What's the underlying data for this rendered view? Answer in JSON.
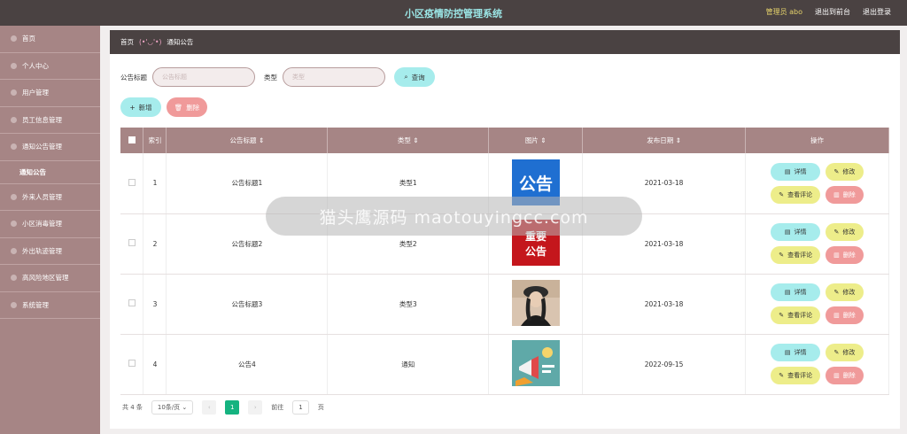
{
  "header": {
    "title": "小区疫情防控管理系统",
    "user": "管理员 abo",
    "to_front": "退出到前台",
    "logout": "退出登录"
  },
  "sidebar": {
    "items": [
      {
        "label": "首页"
      },
      {
        "label": "个人中心"
      },
      {
        "label": "用户管理"
      },
      {
        "label": "员工信息管理"
      },
      {
        "label": "通知公告管理"
      }
    ],
    "sub_active": "通知公告",
    "items_after": [
      {
        "label": "外来人员管理"
      },
      {
        "label": "小区消毒管理"
      },
      {
        "label": "外出轨迹管理"
      },
      {
        "label": "高风险地区管理"
      },
      {
        "label": "系统管理"
      }
    ]
  },
  "breadcrumb": {
    "home": "首页",
    "face": "(•'◡'•)",
    "current": "通知公告"
  },
  "search": {
    "title_label": "公告标题",
    "title_placeholder": "公告标题",
    "type_label": "类型",
    "type_placeholder": "类型",
    "query_button": "查询"
  },
  "toolbar": {
    "add": "新增",
    "delete": "删除"
  },
  "table": {
    "columns": [
      "索引",
      "公告标题",
      "类型",
      "图片",
      "发布日期",
      "操作"
    ],
    "rows": [
      {
        "index": "1",
        "title": "公告标题1",
        "type": "类型1",
        "image": "notice-gonggao-blue",
        "date": "2021-03-18"
      },
      {
        "index": "2",
        "title": "公告标题2",
        "type": "类型2",
        "image": "notice-zhongyao-red",
        "date": "2021-03-18"
      },
      {
        "index": "3",
        "title": "公告标题3",
        "type": "类型3",
        "image": "photo-person",
        "date": "2021-03-18"
      },
      {
        "index": "4",
        "title": "公告4",
        "type": "通知",
        "image": "megaphone-illustration",
        "date": "2022-09-15"
      }
    ],
    "actions": {
      "detail": "详情",
      "edit": "修改",
      "comments": "查看评论",
      "delete": "删除"
    }
  },
  "pagination": {
    "total": "共 4 条",
    "page_size": "10条/页",
    "current_page": "1",
    "goto_label": "前往",
    "goto_value": "1",
    "page_suffix": "页"
  },
  "watermark": "猫头鹰源码 maotouyingcc.com",
  "colors": {
    "header_bg": "#4a4242",
    "sidebar_bg": "#a68585",
    "accent_cyan": "#a6ecec",
    "accent_pink": "#f09a9a",
    "accent_yellow": "#eded8a",
    "pager_active": "#15b380"
  }
}
